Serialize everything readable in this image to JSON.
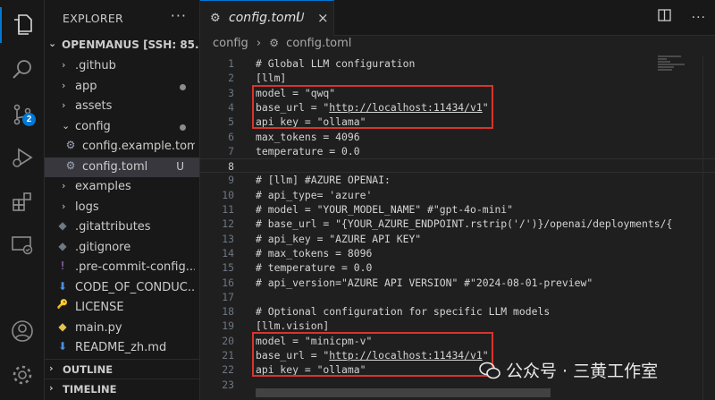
{
  "sidebar": {
    "title": "EXPLORER",
    "more_label": "···",
    "root_label": "OPENMANUS [SSH: 85.1...",
    "items": [
      {
        "label": ".github",
        "kind": "folder"
      },
      {
        "label": "app",
        "kind": "folder",
        "status": "modified-dot"
      },
      {
        "label": "assets",
        "kind": "folder"
      },
      {
        "label": "config",
        "kind": "folder-open",
        "status": "modified-dot"
      },
      {
        "label": "config.example.toml",
        "kind": "gear-file"
      },
      {
        "label": "config.toml",
        "kind": "gear-file",
        "status": "U",
        "selected": true
      },
      {
        "label": "examples",
        "kind": "folder"
      },
      {
        "label": "logs",
        "kind": "folder"
      },
      {
        "label": ".gitattributes",
        "kind": "git-file"
      },
      {
        "label": ".gitignore",
        "kind": "git-file"
      },
      {
        "label": ".pre-commit-config...",
        "kind": "exclaim-file"
      },
      {
        "label": "CODE_OF_CONDUC...",
        "kind": "info-file"
      },
      {
        "label": "LICENSE",
        "kind": "license-file"
      },
      {
        "label": "main.py",
        "kind": "python-file"
      },
      {
        "label": "README_zh.md",
        "kind": "info-file"
      }
    ],
    "sections": [
      "OUTLINE",
      "TIMELINE"
    ]
  },
  "activity_bar": {
    "icons": [
      "files-icon",
      "search-icon",
      "source-control-icon",
      "run-debug-icon",
      "extensions-icon",
      "remote-explorer-icon",
      "account-icon",
      "settings-gear-icon"
    ],
    "source_control_badge": "2"
  },
  "tabs": [
    {
      "label": "config.toml",
      "status": "U",
      "icon": "gear-icon",
      "close": "×"
    }
  ],
  "tab_actions": [
    "split-editor-icon",
    "more-actions-icon"
  ],
  "breadcrumb": {
    "folder": "config",
    "separator": "›",
    "file": "config.toml"
  },
  "editor": {
    "current_line": 8,
    "lines": [
      {
        "n": "1",
        "text": "# Global LLM configuration"
      },
      {
        "n": "2",
        "text": "[llm]"
      },
      {
        "n": "3",
        "text": "model = \"qwq\""
      },
      {
        "n": "4",
        "text": "base_url = \"http://localhost:11434/v1\""
      },
      {
        "n": "5",
        "text": "api_key = \"ollama\""
      },
      {
        "n": "6",
        "text": "max_tokens = 4096"
      },
      {
        "n": "7",
        "text": "temperature = 0.0"
      },
      {
        "n": "8",
        "text": ""
      },
      {
        "n": "9",
        "text": "# [llm] #AZURE OPENAI:"
      },
      {
        "n": "10",
        "text": "# api_type= 'azure'"
      },
      {
        "n": "11",
        "text": "# model = \"YOUR_MODEL_NAME\" #\"gpt-4o-mini\""
      },
      {
        "n": "12",
        "text": "# base_url = \"{YOUR_AZURE_ENDPOINT.rstrip('/')}/openai/deployments/{"
      },
      {
        "n": "13",
        "text": "# api_key = \"AZURE API KEY\""
      },
      {
        "n": "14",
        "text": "# max_tokens = 8096"
      },
      {
        "n": "15",
        "text": "# temperature = 0.0"
      },
      {
        "n": "16",
        "text": "# api_version=\"AZURE API VERSION\" #\"2024-08-01-preview\""
      },
      {
        "n": "17",
        "text": ""
      },
      {
        "n": "18",
        "text": "# Optional configuration for specific LLM models"
      },
      {
        "n": "19",
        "text": "[llm.vision]"
      },
      {
        "n": "20",
        "text": "model = \"minicpm-v\""
      },
      {
        "n": "21",
        "text": "base_url = \"http://localhost:11434/v1\""
      },
      {
        "n": "22",
        "text": "api_key = \"ollama\""
      },
      {
        "n": "23",
        "text": ""
      }
    ]
  },
  "watermark": "公众号 · 三黄工作室",
  "colors": {
    "accent": "#0078d4",
    "highlight_box": "#d8342c",
    "editor_bg": "#1f1f1f",
    "sidebar_bg": "#181818"
  }
}
